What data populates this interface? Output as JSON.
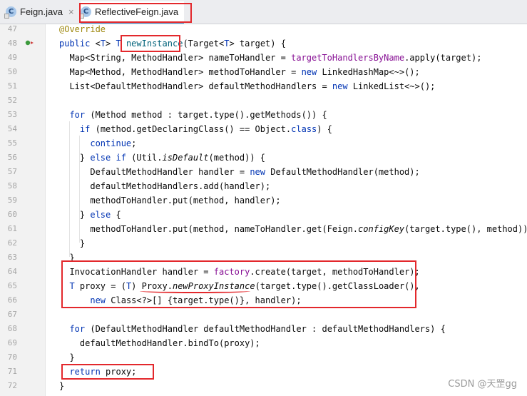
{
  "tabs": [
    {
      "label": "Feign.java",
      "icon": "java-class-icon",
      "close": "×"
    },
    {
      "label": "ReflectiveFeign.java",
      "icon": "java-class-icon",
      "close": "",
      "active": true
    }
  ],
  "gutter": {
    "line_numbers": [
      "47",
      "48",
      "49",
      "50",
      "51",
      "52",
      "53",
      "54",
      "55",
      "56",
      "57",
      "58",
      "59",
      "60",
      "61",
      "62",
      "63",
      "64",
      "65",
      "66",
      "67",
      "68",
      "69",
      "70",
      "71",
      "72"
    ]
  },
  "code": {
    "lines": [
      {
        "n": "47",
        "parts": [
          {
            "t": "@Override",
            "c": "an"
          }
        ]
      },
      {
        "n": "48",
        "parts": [
          {
            "t": "public ",
            "c": "kw"
          },
          {
            "t": "<"
          },
          {
            "t": "T",
            "c": "kw"
          },
          {
            "t": "> "
          },
          {
            "t": "T ",
            "c": "kw"
          },
          {
            "t": "newInstance",
            "c": "fn"
          },
          {
            "t": "(Target<"
          },
          {
            "t": "T",
            "c": "kw"
          },
          {
            "t": "> target) {"
          }
        ]
      },
      {
        "n": "49",
        "parts": [
          {
            "t": "  Map<String, MethodHandler> nameToHandler = "
          },
          {
            "t": "targetToHandlersByName",
            "c": "fld"
          },
          {
            "t": ".apply(target);"
          }
        ]
      },
      {
        "n": "50",
        "parts": [
          {
            "t": "  Map<Method, MethodHandler> methodToHandler = "
          },
          {
            "t": "new ",
            "c": "kw"
          },
          {
            "t": "LinkedHashMap<~>();"
          }
        ]
      },
      {
        "n": "51",
        "parts": [
          {
            "t": "  List<DefaultMethodHandler> defaultMethodHandlers = "
          },
          {
            "t": "new ",
            "c": "kw"
          },
          {
            "t": "LinkedList<~>();"
          }
        ]
      },
      {
        "n": "52",
        "parts": [
          {
            "t": ""
          }
        ]
      },
      {
        "n": "53",
        "parts": [
          {
            "t": "  "
          },
          {
            "t": "for ",
            "c": "kw"
          },
          {
            "t": "(Method method : target.type().getMethods()) {"
          }
        ]
      },
      {
        "n": "54",
        "parts": [
          {
            "t": "    "
          },
          {
            "t": "if ",
            "c": "kw"
          },
          {
            "t": "(method.getDeclaringClass() == Object."
          },
          {
            "t": "class",
            "c": "kw"
          },
          {
            "t": ") {"
          }
        ]
      },
      {
        "n": "55",
        "parts": [
          {
            "t": "      "
          },
          {
            "t": "continue",
            "c": "kw"
          },
          {
            "t": ";"
          }
        ]
      },
      {
        "n": "56",
        "parts": [
          {
            "t": "    } "
          },
          {
            "t": "else if ",
            "c": "kw"
          },
          {
            "t": "(Util."
          },
          {
            "t": "isDefault",
            "c": "it"
          },
          {
            "t": "(method)) {"
          }
        ]
      },
      {
        "n": "57",
        "parts": [
          {
            "t": "      DefaultMethodHandler handler = "
          },
          {
            "t": "new ",
            "c": "kw"
          },
          {
            "t": "DefaultMethodHandler(method);"
          }
        ]
      },
      {
        "n": "58",
        "parts": [
          {
            "t": "      defaultMethodHandlers.add(handler);"
          }
        ]
      },
      {
        "n": "59",
        "parts": [
          {
            "t": "      methodToHandler.put(method, handler);"
          }
        ]
      },
      {
        "n": "60",
        "parts": [
          {
            "t": "    } "
          },
          {
            "t": "else ",
            "c": "kw"
          },
          {
            "t": "{"
          }
        ]
      },
      {
        "n": "61",
        "parts": [
          {
            "t": "      methodToHandler.put(method, nameToHandler.get(Feign."
          },
          {
            "t": "configKey",
            "c": "it"
          },
          {
            "t": "(target.type(), method)));"
          }
        ]
      },
      {
        "n": "62",
        "parts": [
          {
            "t": "    }"
          }
        ]
      },
      {
        "n": "63",
        "parts": [
          {
            "t": "  }"
          }
        ]
      },
      {
        "n": "64",
        "parts": [
          {
            "t": "  InvocationHandler handler = "
          },
          {
            "t": "factory",
            "c": "fld"
          },
          {
            "t": ".create(target, methodToHandler);"
          }
        ]
      },
      {
        "n": "65",
        "parts": [
          {
            "t": "  "
          },
          {
            "t": "T ",
            "c": "kw"
          },
          {
            "t": "proxy = ("
          },
          {
            "t": "T",
            "c": "kw"
          },
          {
            "t": ") Proxy."
          },
          {
            "t": "newProxyInstance",
            "c": "it"
          },
          {
            "t": "(target.type().getClassLoader(),"
          }
        ]
      },
      {
        "n": "66",
        "parts": [
          {
            "t": "      "
          },
          {
            "t": "new ",
            "c": "kw"
          },
          {
            "t": "Class<?>[] {target.type()}, handler);"
          }
        ]
      },
      {
        "n": "67",
        "parts": [
          {
            "t": ""
          }
        ]
      },
      {
        "n": "68",
        "parts": [
          {
            "t": "  "
          },
          {
            "t": "for ",
            "c": "kw"
          },
          {
            "t": "(DefaultMethodHandler defaultMethodHandler : defaultMethodHandlers) {"
          }
        ]
      },
      {
        "n": "69",
        "parts": [
          {
            "t": "    defaultMethodHandler.bindTo(proxy);"
          }
        ]
      },
      {
        "n": "70",
        "parts": [
          {
            "t": "  }"
          }
        ]
      },
      {
        "n": "71",
        "parts": [
          {
            "t": "  "
          },
          {
            "t": "return ",
            "c": "kw"
          },
          {
            "t": "proxy;"
          }
        ]
      },
      {
        "n": "72",
        "parts": [
          {
            "t": "}"
          }
        ]
      }
    ]
  },
  "watermark": "CSDN @天罡gg",
  "colors": {
    "keyword": "#0033b3",
    "annotation": "#9e880d",
    "method_declaration": "#00627a",
    "field": "#871094",
    "highlight_box": "#e3282c",
    "active_tab_underline": "#4a88c7"
  }
}
